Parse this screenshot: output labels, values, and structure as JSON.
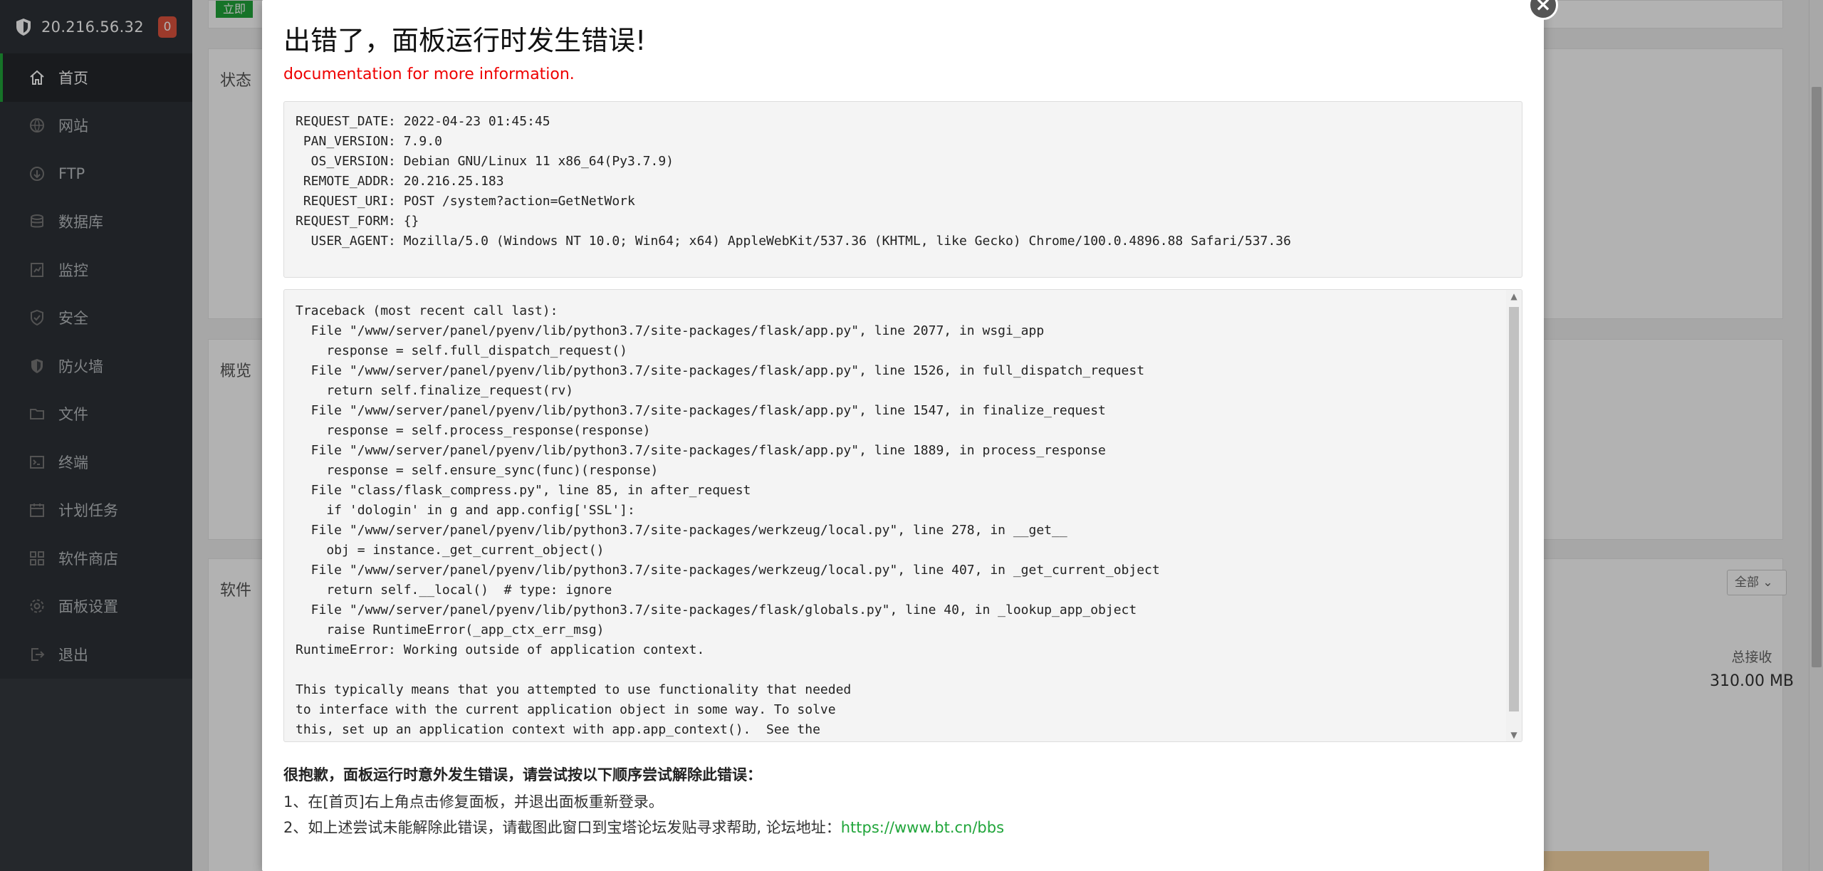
{
  "sidebar": {
    "ip": "20.216.56.32",
    "badge": "0",
    "items": [
      {
        "label": "首页",
        "icon": "home-icon"
      },
      {
        "label": "网站",
        "icon": "globe-icon"
      },
      {
        "label": "FTP",
        "icon": "ftp-icon"
      },
      {
        "label": "数据库",
        "icon": "database-icon"
      },
      {
        "label": "监控",
        "icon": "monitor-icon"
      },
      {
        "label": "安全",
        "icon": "security-shield-icon"
      },
      {
        "label": "防火墙",
        "icon": "firewall-icon"
      },
      {
        "label": "文件",
        "icon": "folder-icon"
      },
      {
        "label": "终端",
        "icon": "terminal-icon"
      },
      {
        "label": "计划任务",
        "icon": "calendar-icon"
      },
      {
        "label": "软件商店",
        "icon": "apps-icon"
      },
      {
        "label": "面板设置",
        "icon": "settings-icon"
      },
      {
        "label": "退出",
        "icon": "logout-icon"
      }
    ]
  },
  "background": {
    "now_button": "立即",
    "status_title": "状态",
    "overview_title": "概览",
    "software_title": "软件",
    "filter_value": "全部",
    "total_received_label": "总接收",
    "total_received_value": "310.00 MB"
  },
  "modal": {
    "title": "出错了，面板运行时发生错误!",
    "doc_note": "documentation for more information.",
    "info_lines": [
      "REQUEST_DATE: 2022-04-23 01:45:45",
      " PAN_VERSION: 7.9.0",
      "  OS_VERSION: Debian GNU/Linux 11 x86_64(Py3.7.9)",
      " REMOTE_ADDR: 20.216.25.183",
      " REQUEST_URI: POST /system?action=GetNetWork",
      "REQUEST_FORM: {}",
      "  USER_AGENT: Mozilla/5.0 (Windows NT 10.0; Win64; x64) AppleWebKit/537.36 (KHTML, like Gecko) Chrome/100.0.4896.88 Safari/537.36"
    ],
    "traceback_lines": [
      "Traceback (most recent call last):",
      "  File \"/www/server/panel/pyenv/lib/python3.7/site-packages/flask/app.py\", line 2077, in wsgi_app",
      "    response = self.full_dispatch_request()",
      "  File \"/www/server/panel/pyenv/lib/python3.7/site-packages/flask/app.py\", line 1526, in full_dispatch_request",
      "    return self.finalize_request(rv)",
      "  File \"/www/server/panel/pyenv/lib/python3.7/site-packages/flask/app.py\", line 1547, in finalize_request",
      "    response = self.process_response(response)",
      "  File \"/www/server/panel/pyenv/lib/python3.7/site-packages/flask/app.py\", line 1889, in process_response",
      "    response = self.ensure_sync(func)(response)",
      "  File \"class/flask_compress.py\", line 85, in after_request",
      "    if 'dologin' in g and app.config['SSL']:",
      "  File \"/www/server/panel/pyenv/lib/python3.7/site-packages/werkzeug/local.py\", line 278, in __get__",
      "    obj = instance._get_current_object()",
      "  File \"/www/server/panel/pyenv/lib/python3.7/site-packages/werkzeug/local.py\", line 407, in _get_current_object",
      "    return self.__local()  # type: ignore",
      "  File \"/www/server/panel/pyenv/lib/python3.7/site-packages/flask/globals.py\", line 40, in _lookup_app_object",
      "    raise RuntimeError(_app_ctx_err_msg)",
      "RuntimeError: Working outside of application context.",
      "",
      "This typically means that you attempted to use functionality that needed",
      "to interface with the current application object in some way. To solve",
      "this, set up an application context with app.app_context().  See the",
      "documentation for more information."
    ],
    "help_title": "很抱歉，面板运行时意外发生错误，请尝试按以下顺序尝试解除此错误：",
    "help_step1": "1、在[首页]右上角点击修复面板，并退出面板重新登录。",
    "help_step2_text": "2、如上述尝试未能解除此错误，请截图此窗口到宝塔论坛发贴寻求帮助, 论坛地址：",
    "help_step2_link": "https://www.bt.cn/bbs"
  }
}
